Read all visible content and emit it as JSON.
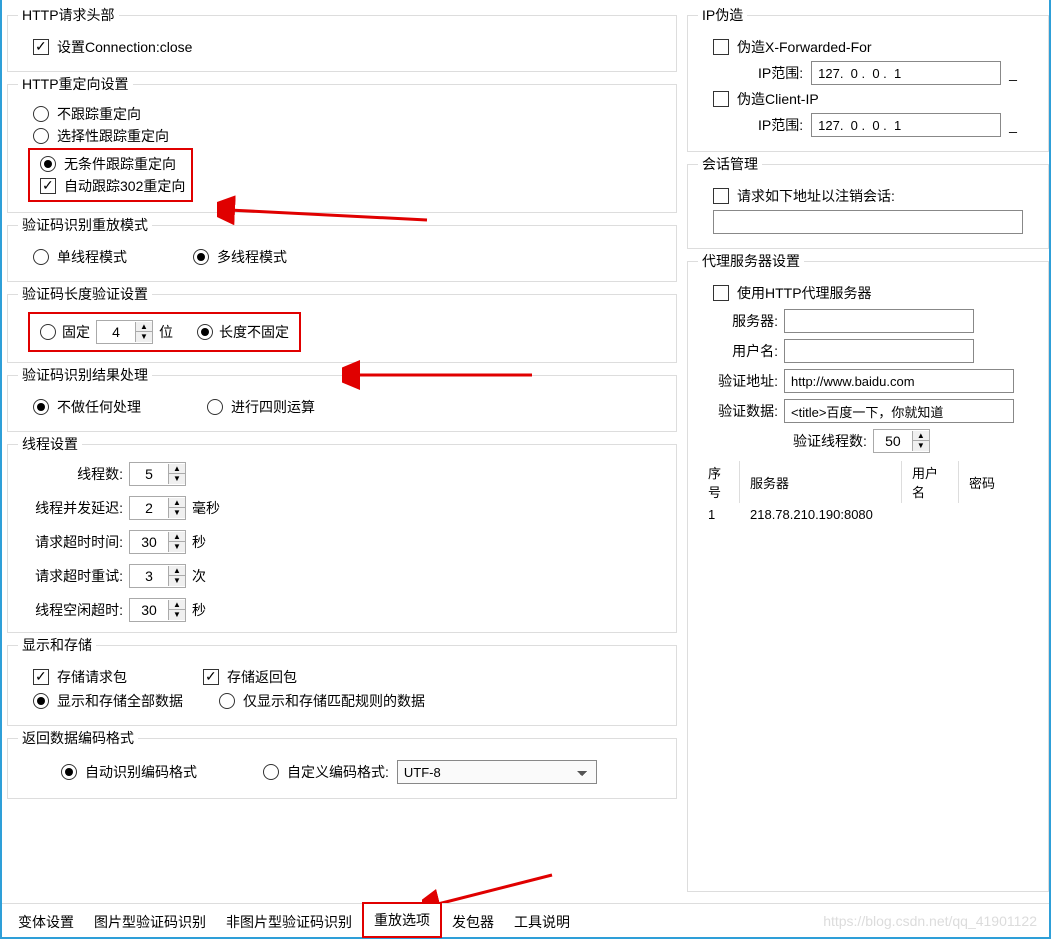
{
  "left": {
    "http_header": {
      "legend": "HTTP请求头部",
      "conn_close": "设置Connection:close"
    },
    "redirect": {
      "legend": "HTTP重定向设置",
      "opt_no": "不跟踪重定向",
      "opt_selective": "选择性跟踪重定向",
      "opt_unconditional": "无条件跟踪重定向",
      "auto302": "自动跟踪302重定向"
    },
    "replay_mode": {
      "legend": "验证码识别重放模式",
      "single": "单线程模式",
      "multi": "多线程模式"
    },
    "captcha_len": {
      "legend": "验证码长度验证设置",
      "fixed": "固定",
      "fixed_val": "4",
      "unit": "位",
      "not_fixed": "长度不固定"
    },
    "captcha_result": {
      "legend": "验证码识别结果处理",
      "none": "不做任何处理",
      "math": "进行四则运算"
    },
    "thread": {
      "legend": "线程设置",
      "count_label": "线程数:",
      "count": "5",
      "delay_label": "线程并发延迟:",
      "delay": "2",
      "delay_unit": "毫秒",
      "timeout_label": "请求超时时间:",
      "timeout": "30",
      "timeout_unit": "秒",
      "retry_label": "请求超时重试:",
      "retry": "3",
      "retry_unit": "次",
      "idle_label": "线程空闲超时:",
      "idle": "30",
      "idle_unit": "秒"
    },
    "storage": {
      "legend": "显示和存储",
      "store_req": "存储请求包",
      "store_resp": "存储返回包",
      "show_all": "显示和存储全部数据",
      "show_match": "仅显示和存储匹配规则的数据"
    },
    "encoding": {
      "legend": "返回数据编码格式",
      "auto": "自动识别编码格式",
      "custom": "自定义编码格式:",
      "value": "UTF-8"
    }
  },
  "right": {
    "ip_spoof": {
      "legend": "IP伪造",
      "xff": "伪造X-Forwarded-For",
      "client_ip": "伪造Client-IP",
      "range_label": "IP范围:",
      "ip": "127.  0 .  0 .  1",
      "dash": "_"
    },
    "session": {
      "legend": "会话管理",
      "logout": "请求如下地址以注销会话:"
    },
    "proxy": {
      "legend": "代理服务器设置",
      "use": "使用HTTP代理服务器",
      "server_label": "服务器:",
      "user_label": "用户名:",
      "verify_url_label": "验证地址:",
      "verify_url": "http://www.baidu.com",
      "verify_data_label": "验证数据:",
      "verify_data": "<title>百度一下，你就知道",
      "threads_label": "验证线程数:",
      "threads": "50",
      "th_seq": "序号",
      "th_server": "服务器",
      "th_user": "用户名",
      "th_pass": "密码",
      "row1_seq": "1",
      "row1_server": "218.78.210.190:8080"
    }
  },
  "tabs": {
    "t1": "变体设置",
    "t2": "图片型验证码识别",
    "t3": "非图片型验证码识别",
    "t4": "重放选项",
    "t5": "发包器",
    "t6": "工具说明"
  },
  "watermark": "https://blog.csdn.net/qq_41901122"
}
